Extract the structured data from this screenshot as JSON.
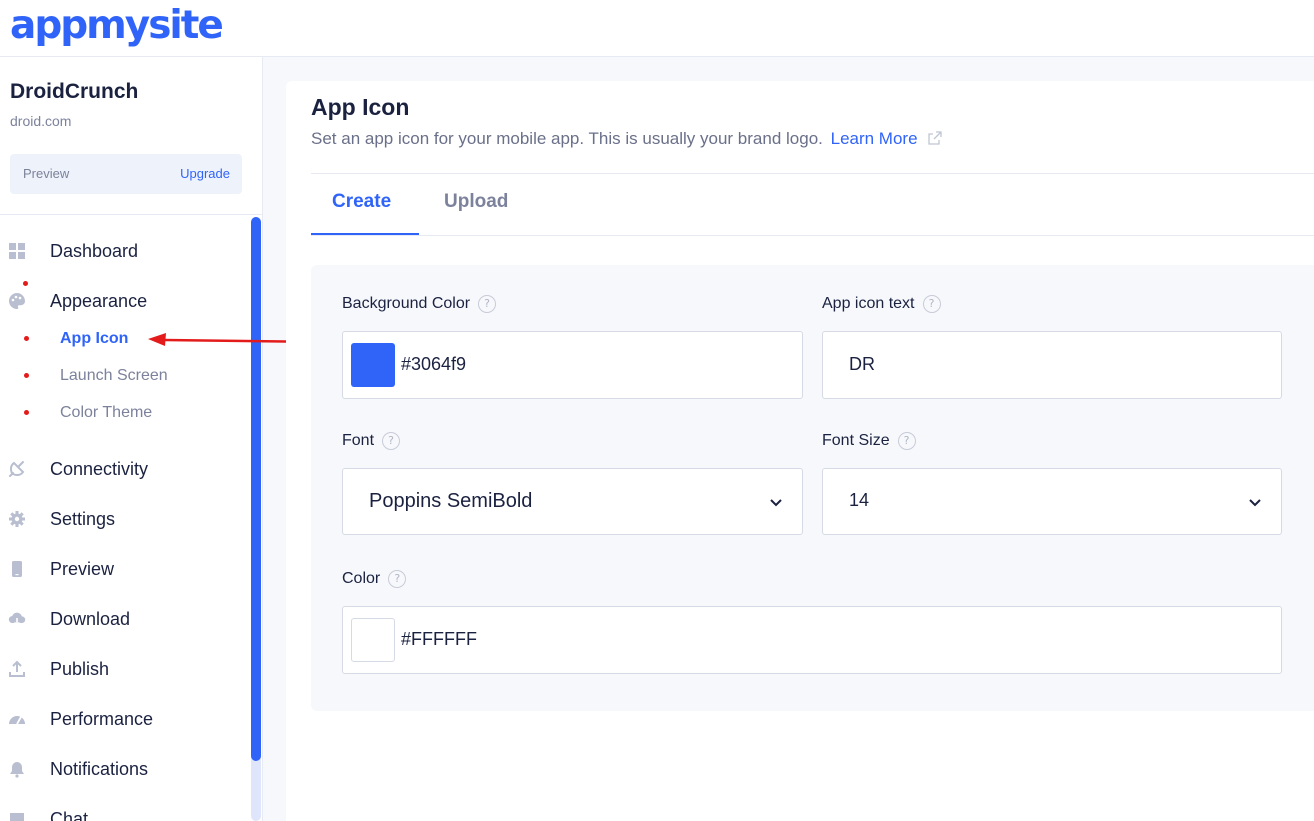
{
  "brand": {
    "logo_text": "appmysite",
    "accent": "#3064f9"
  },
  "site": {
    "name": "DroidCrunch",
    "url": "droid.com"
  },
  "plan": {
    "preview_label": "Preview",
    "upgrade_label": "Upgrade"
  },
  "nav": {
    "dashboard": "Dashboard",
    "appearance": "Appearance",
    "sub": {
      "app_icon": "App Icon",
      "launch_screen": "Launch Screen",
      "color_theme": "Color Theme"
    },
    "connectivity": "Connectivity",
    "settings": "Settings",
    "preview": "Preview",
    "download": "Download",
    "publish": "Publish",
    "performance": "Performance",
    "notifications": "Notifications",
    "chat": "Chat"
  },
  "page": {
    "title": "App Icon",
    "subtitle": "Set an app icon for your mobile app. This is usually your brand logo.",
    "learn_more": "Learn More",
    "tabs": {
      "create": "Create",
      "upload": "Upload"
    }
  },
  "form": {
    "bg_color": {
      "label": "Background Color",
      "value": "#3064f9",
      "swatch": "#3064f9"
    },
    "icon_text": {
      "label": "App icon text",
      "value": "DR"
    },
    "font": {
      "label": "Font",
      "value": "Poppins SemiBold"
    },
    "font_size": {
      "label": "Font Size",
      "value": "14"
    },
    "color": {
      "label": "Color",
      "value": "#FFFFFF",
      "swatch": "#FFFFFF"
    },
    "help_glyph": "?"
  }
}
